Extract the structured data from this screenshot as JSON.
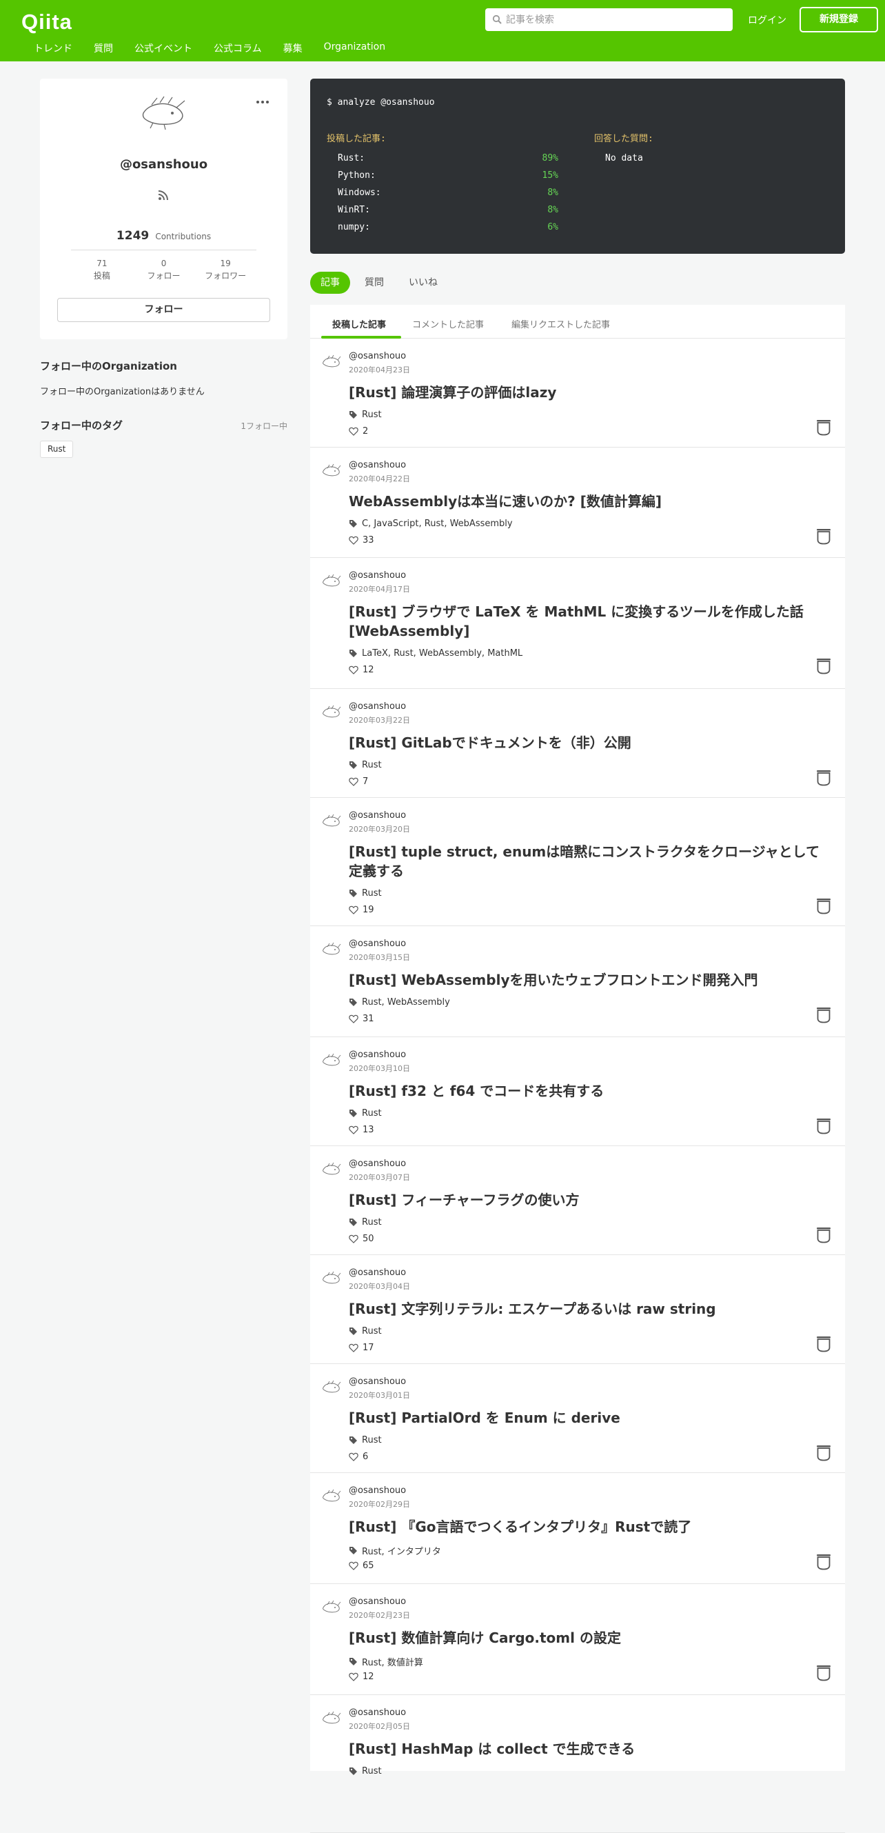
{
  "header": {
    "logo": "Qiita",
    "search_placeholder": "記事を検索",
    "login": "ログイン",
    "signup": "新規登録",
    "nav": [
      "トレンド",
      "質問",
      "公式イベント",
      "公式コラム",
      "募集",
      "Organization"
    ]
  },
  "profile": {
    "username": "@osanshouo",
    "contributions": "1249",
    "contributions_label": "Contributions",
    "stats": [
      {
        "value": "71",
        "label": "投稿"
      },
      {
        "value": "0",
        "label": "フォロー"
      },
      {
        "value": "19",
        "label": "フォロワー"
      }
    ],
    "follow_button": "フォロー"
  },
  "sidebar": {
    "org_heading": "フォロー中のOrganization",
    "org_empty": "フォロー中のOrganizationはありません",
    "tags_heading": "フォロー中のタグ",
    "tags_count": "1フォロー中",
    "tags": [
      "Rust"
    ]
  },
  "terminal": {
    "command": "$ analyze @osanshouo",
    "posted_heading": "投稿した記事:",
    "answered_heading": "回答した質問:",
    "answered_value": "No data",
    "languages": [
      {
        "name": "Rust:",
        "pct": "89%"
      },
      {
        "name": "Python:",
        "pct": "15%"
      },
      {
        "name": "Windows:",
        "pct": "8%"
      },
      {
        "name": "WinRT:",
        "pct": "8%"
      },
      {
        "name": "numpy:",
        "pct": "6%"
      }
    ]
  },
  "type_tabs": [
    "記事",
    "質問",
    "いいね"
  ],
  "sub_tabs": [
    "投稿した記事",
    "コメントした記事",
    "編集リクエストした記事"
  ],
  "articles": [
    {
      "user": "@osanshouo",
      "date": "2020年04月23日",
      "title": "[Rust] 論理演算子の評価はlazy",
      "tags": "Rust",
      "likes": "2"
    },
    {
      "user": "@osanshouo",
      "date": "2020年04月22日",
      "title": "WebAssemblyは本当に速いのか? [数値計算編]",
      "tags": "C, JavaScript, Rust, WebAssembly",
      "likes": "33"
    },
    {
      "user": "@osanshouo",
      "date": "2020年04月17日",
      "title": "[Rust] ブラウザで LaTeX を MathML に変換するツールを作成した話 [WebAssembly]",
      "tags": "LaTeX, Rust, WebAssembly, MathML",
      "likes": "12"
    },
    {
      "user": "@osanshouo",
      "date": "2020年03月22日",
      "title": "[Rust] GitLabでドキュメントを（非）公開",
      "tags": "Rust",
      "likes": "7"
    },
    {
      "user": "@osanshouo",
      "date": "2020年03月20日",
      "title": "[Rust] tuple struct, enumは暗黙にコンストラクタをクロージャとして定義する",
      "tags": "Rust",
      "likes": "19"
    },
    {
      "user": "@osanshouo",
      "date": "2020年03月15日",
      "title": "[Rust] WebAssemblyを用いたウェブフロントエンド開発入門",
      "tags": "Rust, WebAssembly",
      "likes": "31"
    },
    {
      "user": "@osanshouo",
      "date": "2020年03月10日",
      "title": "[Rust] f32 と f64 でコードを共有する",
      "tags": "Rust",
      "likes": "13"
    },
    {
      "user": "@osanshouo",
      "date": "2020年03月07日",
      "title": "[Rust] フィーチャーフラグの使い方",
      "tags": "Rust",
      "likes": "50"
    },
    {
      "user": "@osanshouo",
      "date": "2020年03月04日",
      "title": "[Rust] 文字列リテラル: エスケープあるいは raw string",
      "tags": "Rust",
      "likes": "17"
    },
    {
      "user": "@osanshouo",
      "date": "2020年03月01日",
      "title": "[Rust] PartialOrd を Enum に derive",
      "tags": "Rust",
      "likes": "6"
    },
    {
      "user": "@osanshouo",
      "date": "2020年02月29日",
      "title": "[Rust] 『Go言語でつくるインタプリタ』Rustで読了",
      "tags": "Rust, インタプリタ",
      "likes": "65"
    },
    {
      "user": "@osanshouo",
      "date": "2020年02月23日",
      "title": "[Rust] 数値計算向け Cargo.toml の設定",
      "tags": "Rust, 数値計算",
      "likes": "12"
    },
    {
      "user": "@osanshouo",
      "date": "2020年02月05日",
      "title": "[Rust] HashMap は collect で生成できる",
      "tags": "Rust",
      "likes": ""
    }
  ]
}
